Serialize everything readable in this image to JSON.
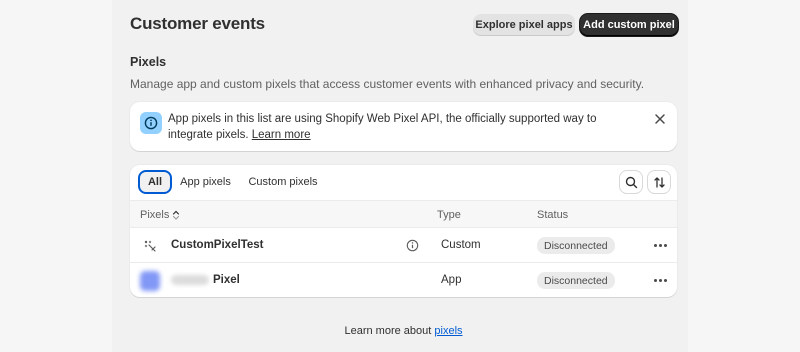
{
  "header": {
    "title": "Customer events",
    "explore_button": "Explore pixel apps",
    "add_button": "Add custom pixel"
  },
  "section": {
    "title": "Pixels",
    "description": "Manage app and custom pixels that access customer events with enhanced privacy and security."
  },
  "banner": {
    "text": "App pixels in this list are using Shopify Web Pixel API, the officially supported way to integrate pixels.",
    "link": "Learn more",
    "icon": "info-icon",
    "close_icon": "close-icon"
  },
  "tabs": [
    {
      "label": "All",
      "selected": true
    },
    {
      "label": "App pixels",
      "selected": false
    },
    {
      "label": "Custom pixels",
      "selected": false
    }
  ],
  "tools": {
    "search_icon": "search-icon",
    "sort_icon": "sort-icon"
  },
  "table": {
    "headers": {
      "pixels": "Pixels",
      "type": "Type",
      "status": "Status"
    },
    "rows": [
      {
        "name": "CustomPixelTest",
        "type": "Custom",
        "status": "Disconnected",
        "icon": "custom-pixel-icon"
      },
      {
        "name": "Pixel",
        "type": "App",
        "status": "Disconnected",
        "icon": "app-logo"
      }
    ]
  },
  "footer": {
    "prefix": "Learn more about",
    "link": "pixels"
  },
  "colors": {
    "primary_button": "#303030",
    "link": "#005bd3",
    "banner_icon_bg": "#91d0ff",
    "tab_focus": "#005bd3"
  }
}
